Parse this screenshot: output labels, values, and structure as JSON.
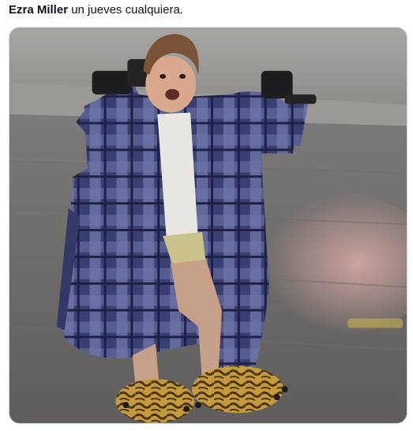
{
  "tweet": {
    "name": "Ezra Miller",
    "text": " un jueves cualquiera.",
    "media": {
      "icon": "photo-person-bathrobe-running"
    }
  },
  "colors": {
    "text": "#0f1419",
    "border": "#cfd9de"
  }
}
